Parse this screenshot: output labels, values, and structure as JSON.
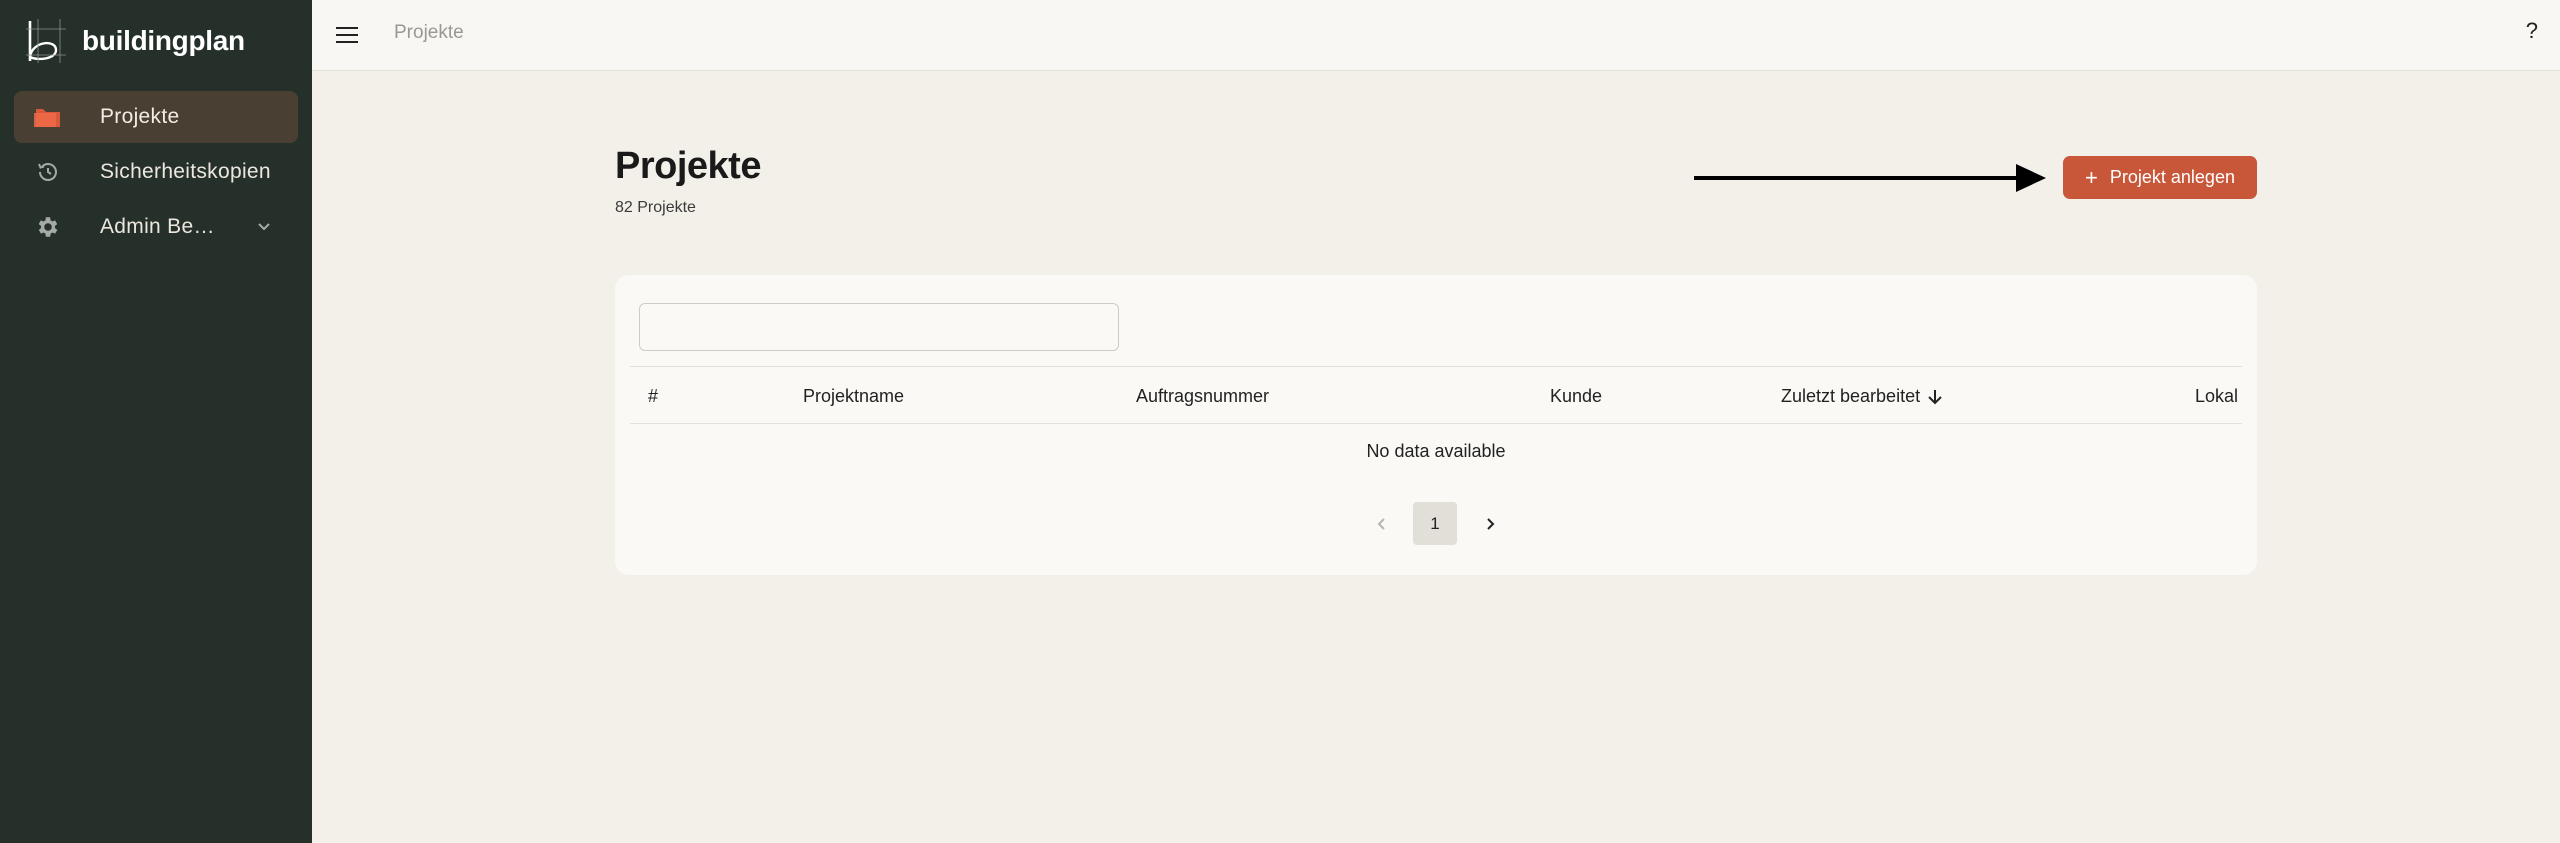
{
  "brand": {
    "name": "buildingplan"
  },
  "sidebar": {
    "items": [
      {
        "label": "Projekte",
        "icon": "folder-icon",
        "active": true
      },
      {
        "label": "Sicherheitskopien",
        "icon": "history-icon",
        "active": false
      },
      {
        "label": "Admin Be…",
        "icon": "gear-icon",
        "active": false
      }
    ]
  },
  "topbar": {
    "breadcrumb": "Projekte",
    "help": "?"
  },
  "page": {
    "title": "Projekte",
    "subtitle": "82 Projekte",
    "create_button": "Projekt anlegen"
  },
  "search": {
    "placeholder": "",
    "value": ""
  },
  "table": {
    "columns": [
      "#",
      "Projektname",
      "Auftragsnummer",
      "Kunde",
      "Zuletzt bearbeitet",
      "Lokal"
    ],
    "sorted_column": "Zuletzt bearbeitet",
    "sort_direction": "desc",
    "empty_message": "No data available"
  },
  "pagination": {
    "current_page": "1"
  },
  "colors": {
    "sidebar_bg": "#25302a",
    "accent": "#c8573a",
    "active_nav_bg": "#4a3f33",
    "page_bg": "#f3f0ea"
  }
}
